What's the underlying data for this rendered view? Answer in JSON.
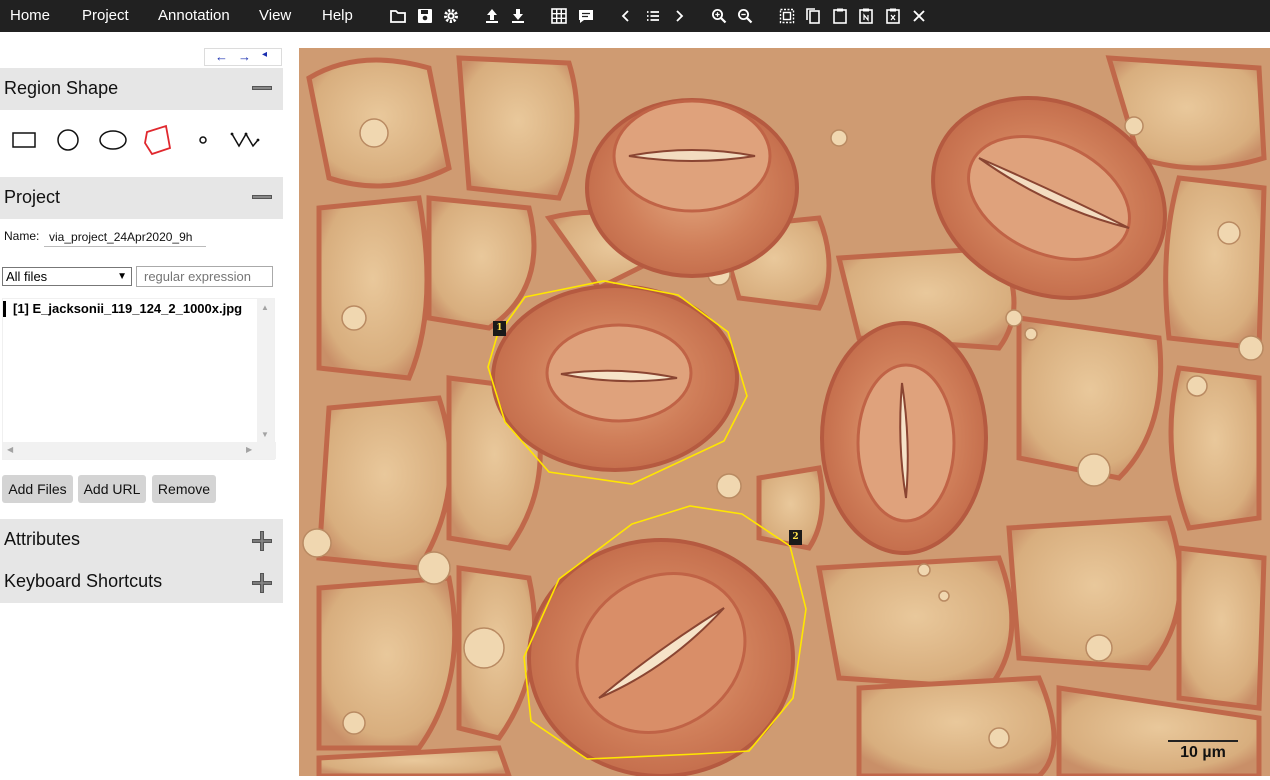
{
  "menu": {
    "items": [
      "Home",
      "Project",
      "Annotation",
      "View",
      "Help"
    ]
  },
  "toolbar": {
    "icons": [
      "folder-open-icon",
      "save-icon",
      "settings-gear-icon",
      "upload-icon",
      "download-icon",
      "grid-view-icon",
      "comment-icon",
      "previous-icon",
      "list-icon",
      "next-icon",
      "zoom-in-icon",
      "zoom-out-icon",
      "select-all-icon",
      "copy-icon",
      "paste-icon",
      "paste-n-icon",
      "paste-x-icon",
      "close-icon"
    ]
  },
  "nav_arrows": {
    "left": "←",
    "right": "→",
    "collapse": "◂"
  },
  "region_shape": {
    "title": "Region Shape",
    "toggle": "−",
    "shapes": [
      "rectangle",
      "circle",
      "ellipse",
      "polygon",
      "point",
      "polyline"
    ],
    "selected": "polygon",
    "selected_color": "#e0282e"
  },
  "project": {
    "title": "Project",
    "toggle": "−",
    "name_label": "Name:",
    "name_value": "via_project_24Apr2020_9h",
    "filter_value": "All files",
    "regex_placeholder": "regular expression",
    "files": [
      {
        "label": "[1] E_jacksonii_119_124_2_1000x.jpg"
      }
    ],
    "buttons": [
      "Add Files",
      "Add URL",
      "Remove"
    ]
  },
  "attributes": {
    "title": "Attributes",
    "toggle": "+"
  },
  "keyboard_shortcuts": {
    "title": "Keyboard Shortcuts",
    "toggle": "+"
  },
  "viewer": {
    "image_name": "E_jacksonii_119_124_2_1000x.jpg",
    "region_color": "#ffe600",
    "regions": [
      {
        "id": "1"
      },
      {
        "id": "2"
      }
    ],
    "scale_bar_label": "10 µm"
  },
  "colors": {
    "topbar": "#212121",
    "panel_header": "#e6e6e6",
    "button": "#d4d4d4"
  }
}
